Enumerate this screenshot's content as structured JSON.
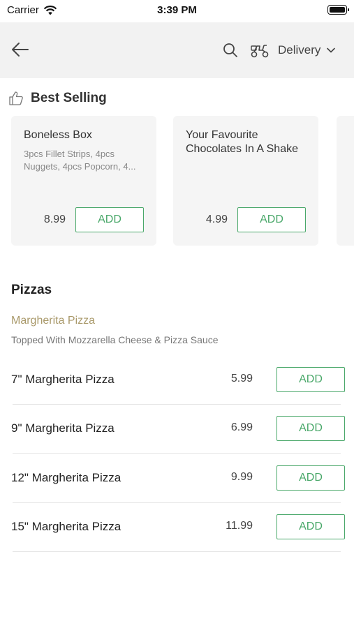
{
  "status_bar": {
    "carrier": "Carrier",
    "time": "3:39 PM"
  },
  "header": {
    "delivery_label": "Delivery",
    "icons": [
      "back-arrow-icon",
      "search-icon",
      "scooter-icon",
      "chevron-down-icon"
    ]
  },
  "best_selling": {
    "title": "Best Selling",
    "items": [
      {
        "title": "Boneless Box",
        "description": "3pcs Fillet Strips, 4pcs Nuggets, 4pcs Popcorn, 4...",
        "price": "8.99",
        "add_label": "ADD"
      },
      {
        "title": "Your Favourite Chocolates In A Shake",
        "description": "",
        "price": "4.99",
        "add_label": "ADD"
      }
    ]
  },
  "pizzas": {
    "title": "Pizzas",
    "category_name": "Margherita Pizza",
    "category_description": "Topped With Mozzarella Cheese & Pizza Sauce",
    "items": [
      {
        "name": "7\" Margherita Pizza",
        "price": "5.99",
        "add_label": "ADD"
      },
      {
        "name": "9\" Margherita Pizza",
        "price": "6.99",
        "add_label": "ADD"
      },
      {
        "name": "12\" Margherita Pizza",
        "price": "9.99",
        "add_label": "ADD"
      },
      {
        "name": "15\" Margherita Pizza",
        "price": "11.99",
        "add_label": "ADD"
      }
    ]
  },
  "colors": {
    "accent": "#4aa86a",
    "category_gold": "#a9996a",
    "header_bg": "#f2f2f2",
    "card_bg": "#f5f5f5"
  }
}
